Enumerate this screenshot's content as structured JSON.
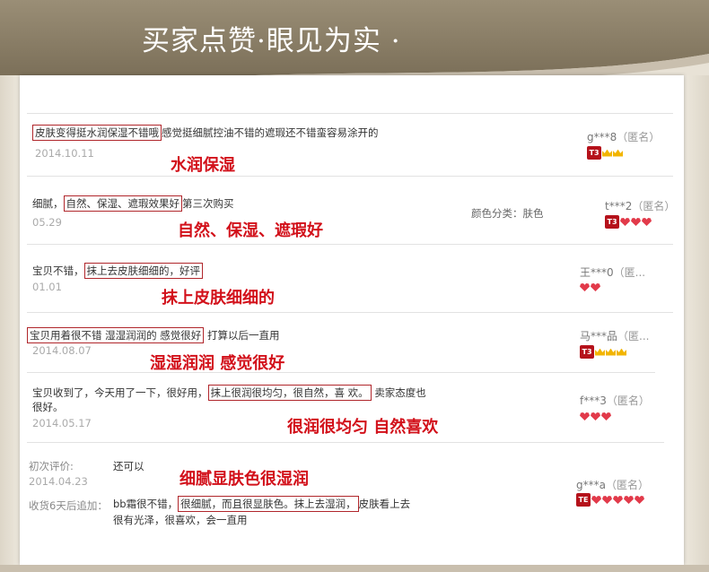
{
  "header": {
    "title": "买家点赞·眼见为实 ·"
  },
  "reviews": [
    {
      "segments": [
        "",
        "皮肤变得挺水润保湿不错哦",
        "感觉挺细腻控油不错的遮瑕还不错蛮容易涂开的"
      ],
      "date": "2014.10.11",
      "annotation": "水润保湿",
      "user": "g***8",
      "anon": "（匿名）",
      "badge": [
        "tmall-logo-icon",
        "crown-icon",
        "crown-icon"
      ]
    },
    {
      "segments": [
        "细腻，",
        "自然、保湿、遮瑕效果好",
        "第三次购买"
      ],
      "date": "05.29",
      "annotation": "自然、保湿、遮瑕好",
      "color_label": "颜色分类：肤色",
      "user": "t***2",
      "anon": "（匿名）",
      "badge": [
        "tmall-logo-icon",
        "heart-icon",
        "heart-icon",
        "heart-icon"
      ]
    },
    {
      "segments": [
        "宝贝不错，",
        "抹上去皮肤细细的，好评",
        ""
      ],
      "date": "01.01",
      "annotation": "抹上皮肤细细的",
      "user": "王***0",
      "anon": "（匿...",
      "badge": [
        "heart-icon",
        "heart-icon"
      ]
    },
    {
      "segments": [
        "",
        "宝贝用着很不错 湿湿润润的 感觉很好",
        "打算以后一直用"
      ],
      "date": "2014.08.07",
      "annotation": "湿湿润润 感觉很好",
      "user": "马***品",
      "anon": "（匿...",
      "badge": [
        "tmall-logo-icon",
        "crown-icon",
        "crown-icon",
        "crown-icon"
      ]
    },
    {
      "segments": [
        "宝贝收到了，今天用了一下，很好用，",
        "抹上很润很均匀，很自然，喜 欢。",
        "卖家态度也"
      ],
      "line2": "很好。",
      "date": "2014.05.17",
      "annotation": "很润很均匀 自然喜欢",
      "user": "f***3",
      "anon": "（匿名）",
      "badge": [
        "heart-icon",
        "heart-icon",
        "heart-icon"
      ]
    },
    {
      "first_label": "初次评价:",
      "first_text": "还可以",
      "date": "2014.04.23",
      "annotation": "细腻显肤色很湿润",
      "followup_label": "收货6天后追加：",
      "segments": [
        "bb霜很不错，",
        "很细腻，而且很显肤色。抹上去湿润，",
        "皮肤看上去"
      ],
      "line2": "很有光泽，很喜欢，会一直用",
      "user": "g***a",
      "anon": "（匿名）",
      "badge": [
        "tmall-logo-icon",
        "heart-icon",
        "heart-icon",
        "heart-icon",
        "heart-icon",
        "heart-icon"
      ]
    }
  ],
  "colors": {
    "annotation": "#d2101a",
    "highlight_border": "#b0262b",
    "header_band": "#8a7d63"
  }
}
